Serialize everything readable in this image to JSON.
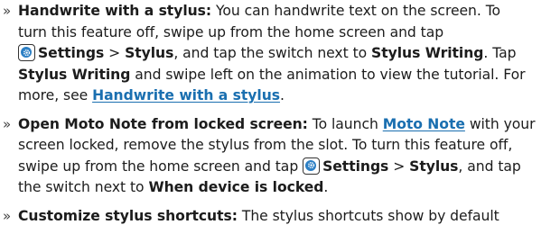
{
  "items": [
    {
      "lines": [
        {
          "bold": "Handwrite with a stylus:",
          "text": " You can handwrite text on the screen. To"
        },
        {
          "text": "turn this feature off, swipe up from the home screen and tap"
        },
        {
          "bold1": "Settings",
          "t1": " > ",
          "bold2": "Stylus",
          "t2": ", and tap the switch next to ",
          "bold3": "Stylus Writing",
          "t3": ". Tap"
        },
        {
          "bold": "Stylus Writing",
          "text": " and swipe left on the animation to view the tutorial. For"
        },
        {
          "text": "more, see ",
          "link": "Handwrite with a stylus",
          "end": "."
        }
      ]
    },
    {
      "lines": [
        {
          "bold": "Open Moto Note from locked screen:",
          "text": " To launch ",
          "link": "Moto Note",
          "end": " with your"
        },
        {
          "text": "screen locked, remove the stylus from the slot. To turn this feature off,"
        },
        {
          "text": "swipe up from the home screen and tap ",
          "bold1": "Settings",
          "t1": " > ",
          "bold2": "Stylus",
          "t2": ", and tap"
        },
        {
          "text": "the switch next to ",
          "bold": "When device is locked",
          "end": "."
        }
      ]
    },
    {
      "lines": [
        {
          "bold": "Customize stylus shortcuts:",
          "text": " The stylus shortcuts show by default"
        }
      ]
    }
  ],
  "bullet_char": "»",
  "icons": {
    "settings": "settings-gear-icon"
  },
  "colors": {
    "link": "#1a6fb0",
    "icon_disc": "#2c7fc4"
  }
}
